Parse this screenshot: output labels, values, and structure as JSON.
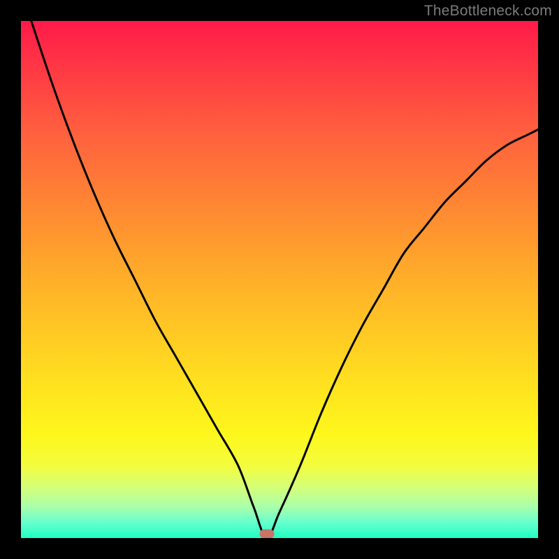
{
  "watermark": "TheBottleneck.com",
  "marker": {
    "x_pct": 47.5,
    "y_pct": 99.2
  },
  "colors": {
    "frame": "#000000",
    "marker": "#c87468",
    "curve": "#000000"
  },
  "chart_data": {
    "type": "line",
    "title": "",
    "xlabel": "",
    "ylabel": "",
    "xlim": [
      0,
      100
    ],
    "ylim": [
      0,
      100
    ],
    "series": [
      {
        "name": "curve",
        "x": [
          2,
          6,
          10,
          14,
          18,
          22,
          26,
          30,
          34,
          38,
          42,
          45,
          47.5,
          50,
          54,
          58,
          62,
          66,
          70,
          74,
          78,
          82,
          86,
          90,
          94,
          98,
          100
        ],
        "y": [
          100,
          88,
          77,
          67,
          58,
          50,
          42,
          35,
          28,
          21,
          14,
          6,
          0,
          5,
          14,
          24,
          33,
          41,
          48,
          55,
          60,
          65,
          69,
          73,
          76,
          78,
          79
        ]
      }
    ],
    "annotations": [
      {
        "type": "marker",
        "x": 47.5,
        "y": 0,
        "label": ""
      }
    ],
    "background_gradient": {
      "direction": "vertical",
      "stops": [
        {
          "pos": 0.0,
          "color": "#ff1a49"
        },
        {
          "pos": 0.5,
          "color": "#ffb828"
        },
        {
          "pos": 0.85,
          "color": "#fdf71c"
        },
        {
          "pos": 1.0,
          "color": "#1fffc2"
        }
      ]
    }
  }
}
